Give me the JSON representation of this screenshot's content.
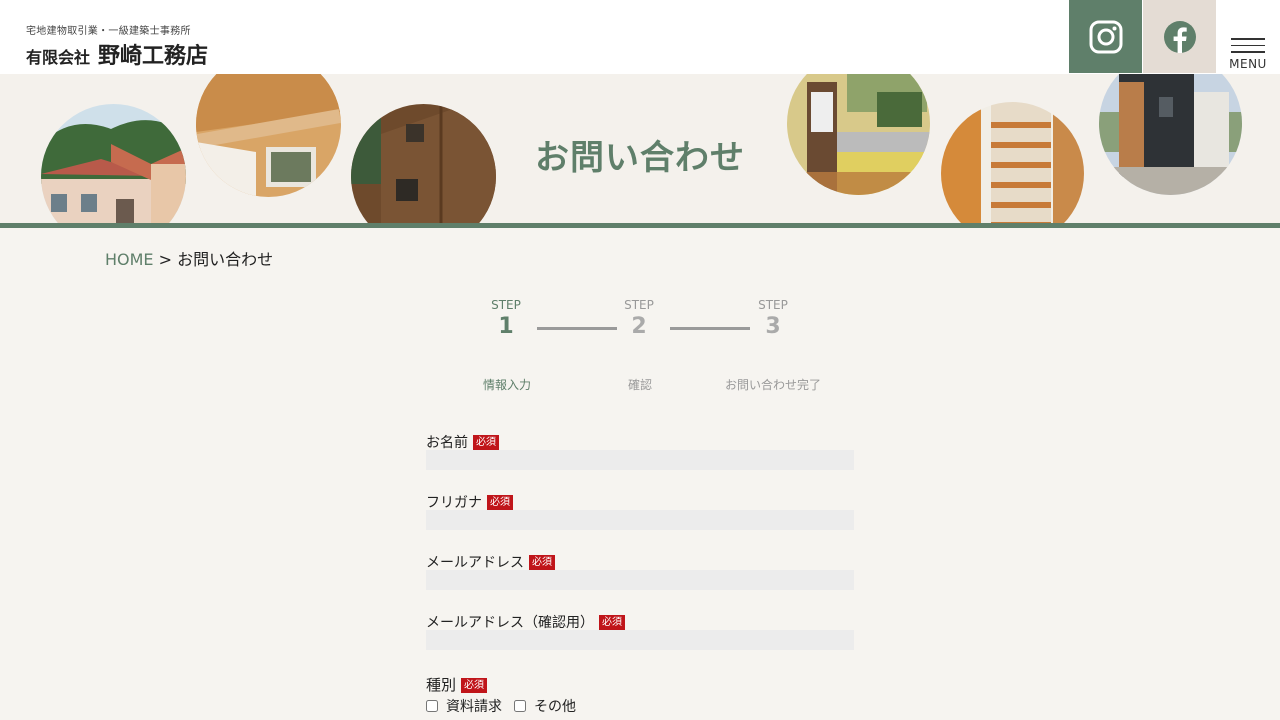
{
  "header": {
    "subtitle": "宅地建物取引業・一級建築士事務所",
    "company_prefix": "有限会社",
    "company_name": "野崎工務店",
    "instagram_icon": "instagram-icon",
    "facebook_icon": "facebook-icon",
    "menu_label": "MENU",
    "colors": {
      "accent": "#5f7f6a",
      "facebook_bg": "#e4dcd4"
    }
  },
  "hero": {
    "title": "お問い合わせ"
  },
  "breadcrumb": {
    "home": "HOME",
    "separator": ">",
    "current": "お問い合わせ"
  },
  "steps": [
    {
      "label": "STEP",
      "number": "1",
      "caption": "情報入力"
    },
    {
      "label": "STEP",
      "number": "2",
      "caption": "確認"
    },
    {
      "label": "STEP",
      "number": "3",
      "caption": "お問い合わせ完了"
    }
  ],
  "form": {
    "required_badge": "必須",
    "fields": [
      {
        "label": "お名前",
        "value": ""
      },
      {
        "label": "フリガナ",
        "value": ""
      },
      {
        "label": "メールアドレス",
        "value": ""
      },
      {
        "label": "メールアドレス（確認用）",
        "value": ""
      }
    ],
    "category": {
      "label": "種別",
      "options": [
        "資料請求",
        "その他"
      ]
    }
  }
}
